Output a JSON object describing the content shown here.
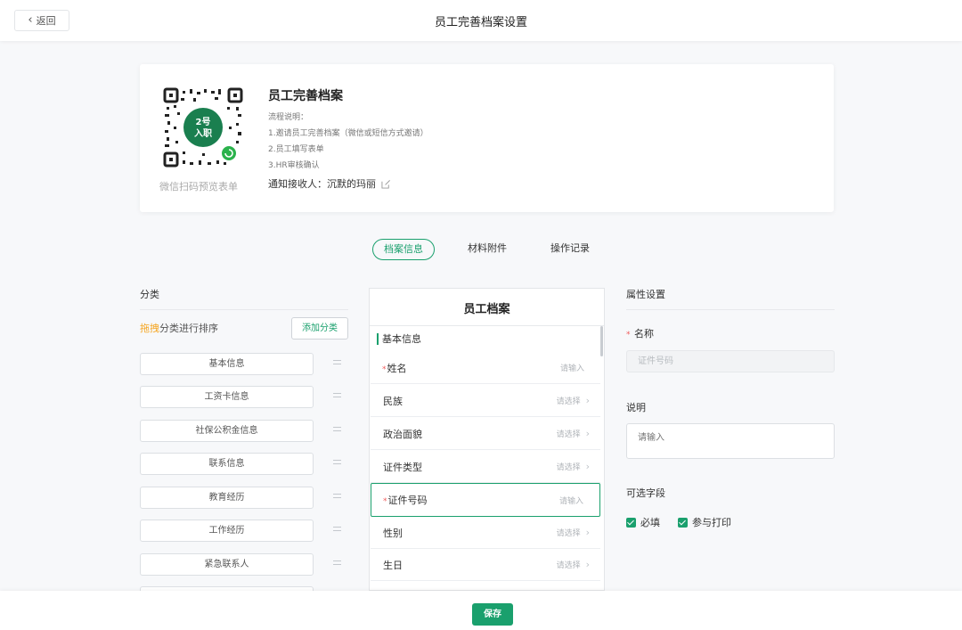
{
  "header": {
    "back_label": "返回",
    "title": "员工完善档案设置"
  },
  "card": {
    "qr_caption": "微信扫码预览表单",
    "logo_text_line1": "2号",
    "logo_text_line2": "入职",
    "title": "员工完善档案",
    "process_title": "流程说明：",
    "steps": [
      "1.邀请员工完善档案（微信或短信方式邀请）",
      "2.员工填写表单",
      "3.HR审核确认"
    ],
    "notify_label": "通知接收人：沉默的玛丽"
  },
  "tabs": [
    {
      "label": "档案信息"
    },
    {
      "label": "材料附件"
    },
    {
      "label": "操作记录"
    }
  ],
  "categories": {
    "title": "分类",
    "hint_highlight": "拖拽",
    "hint_rest": "分类进行排序",
    "add_button": "添加分类",
    "items": [
      "基本信息",
      "工资卡信息",
      "社保公积金信息",
      "联系信息",
      "教育经历",
      "工作经历",
      "紧急联系人"
    ]
  },
  "form": {
    "title": "员工档案",
    "group": "基本信息",
    "fields": [
      {
        "label": "姓名",
        "required": "*",
        "hint": "请输入",
        "chevron": ""
      },
      {
        "label": "民族",
        "required": "",
        "hint": "请选择",
        "chevron": "›"
      },
      {
        "label": "政治面貌",
        "required": "",
        "hint": "请选择",
        "chevron": "›"
      },
      {
        "label": "证件类型",
        "required": "",
        "hint": "请选择",
        "chevron": "›"
      },
      {
        "label": "证件号码",
        "required": "*",
        "hint": "请输入",
        "chevron": ""
      },
      {
        "label": "性别",
        "required": "",
        "hint": "请选择",
        "chevron": "›"
      },
      {
        "label": "生日",
        "required": "",
        "hint": "请选择",
        "chevron": "›"
      }
    ]
  },
  "properties": {
    "title": "属性设置",
    "name_required": "*",
    "name_label": "名称",
    "name_value": "证件号码",
    "desc_label": "说明",
    "desc_placeholder": "请输入",
    "optional_label": "可选字段",
    "check_required": "必填",
    "check_print": "参与打印"
  },
  "footer": {
    "save_label": "保存"
  },
  "colors": {
    "accent": "#1aa06d",
    "highlight": "#f5a623",
    "required": "#f05a5a"
  }
}
